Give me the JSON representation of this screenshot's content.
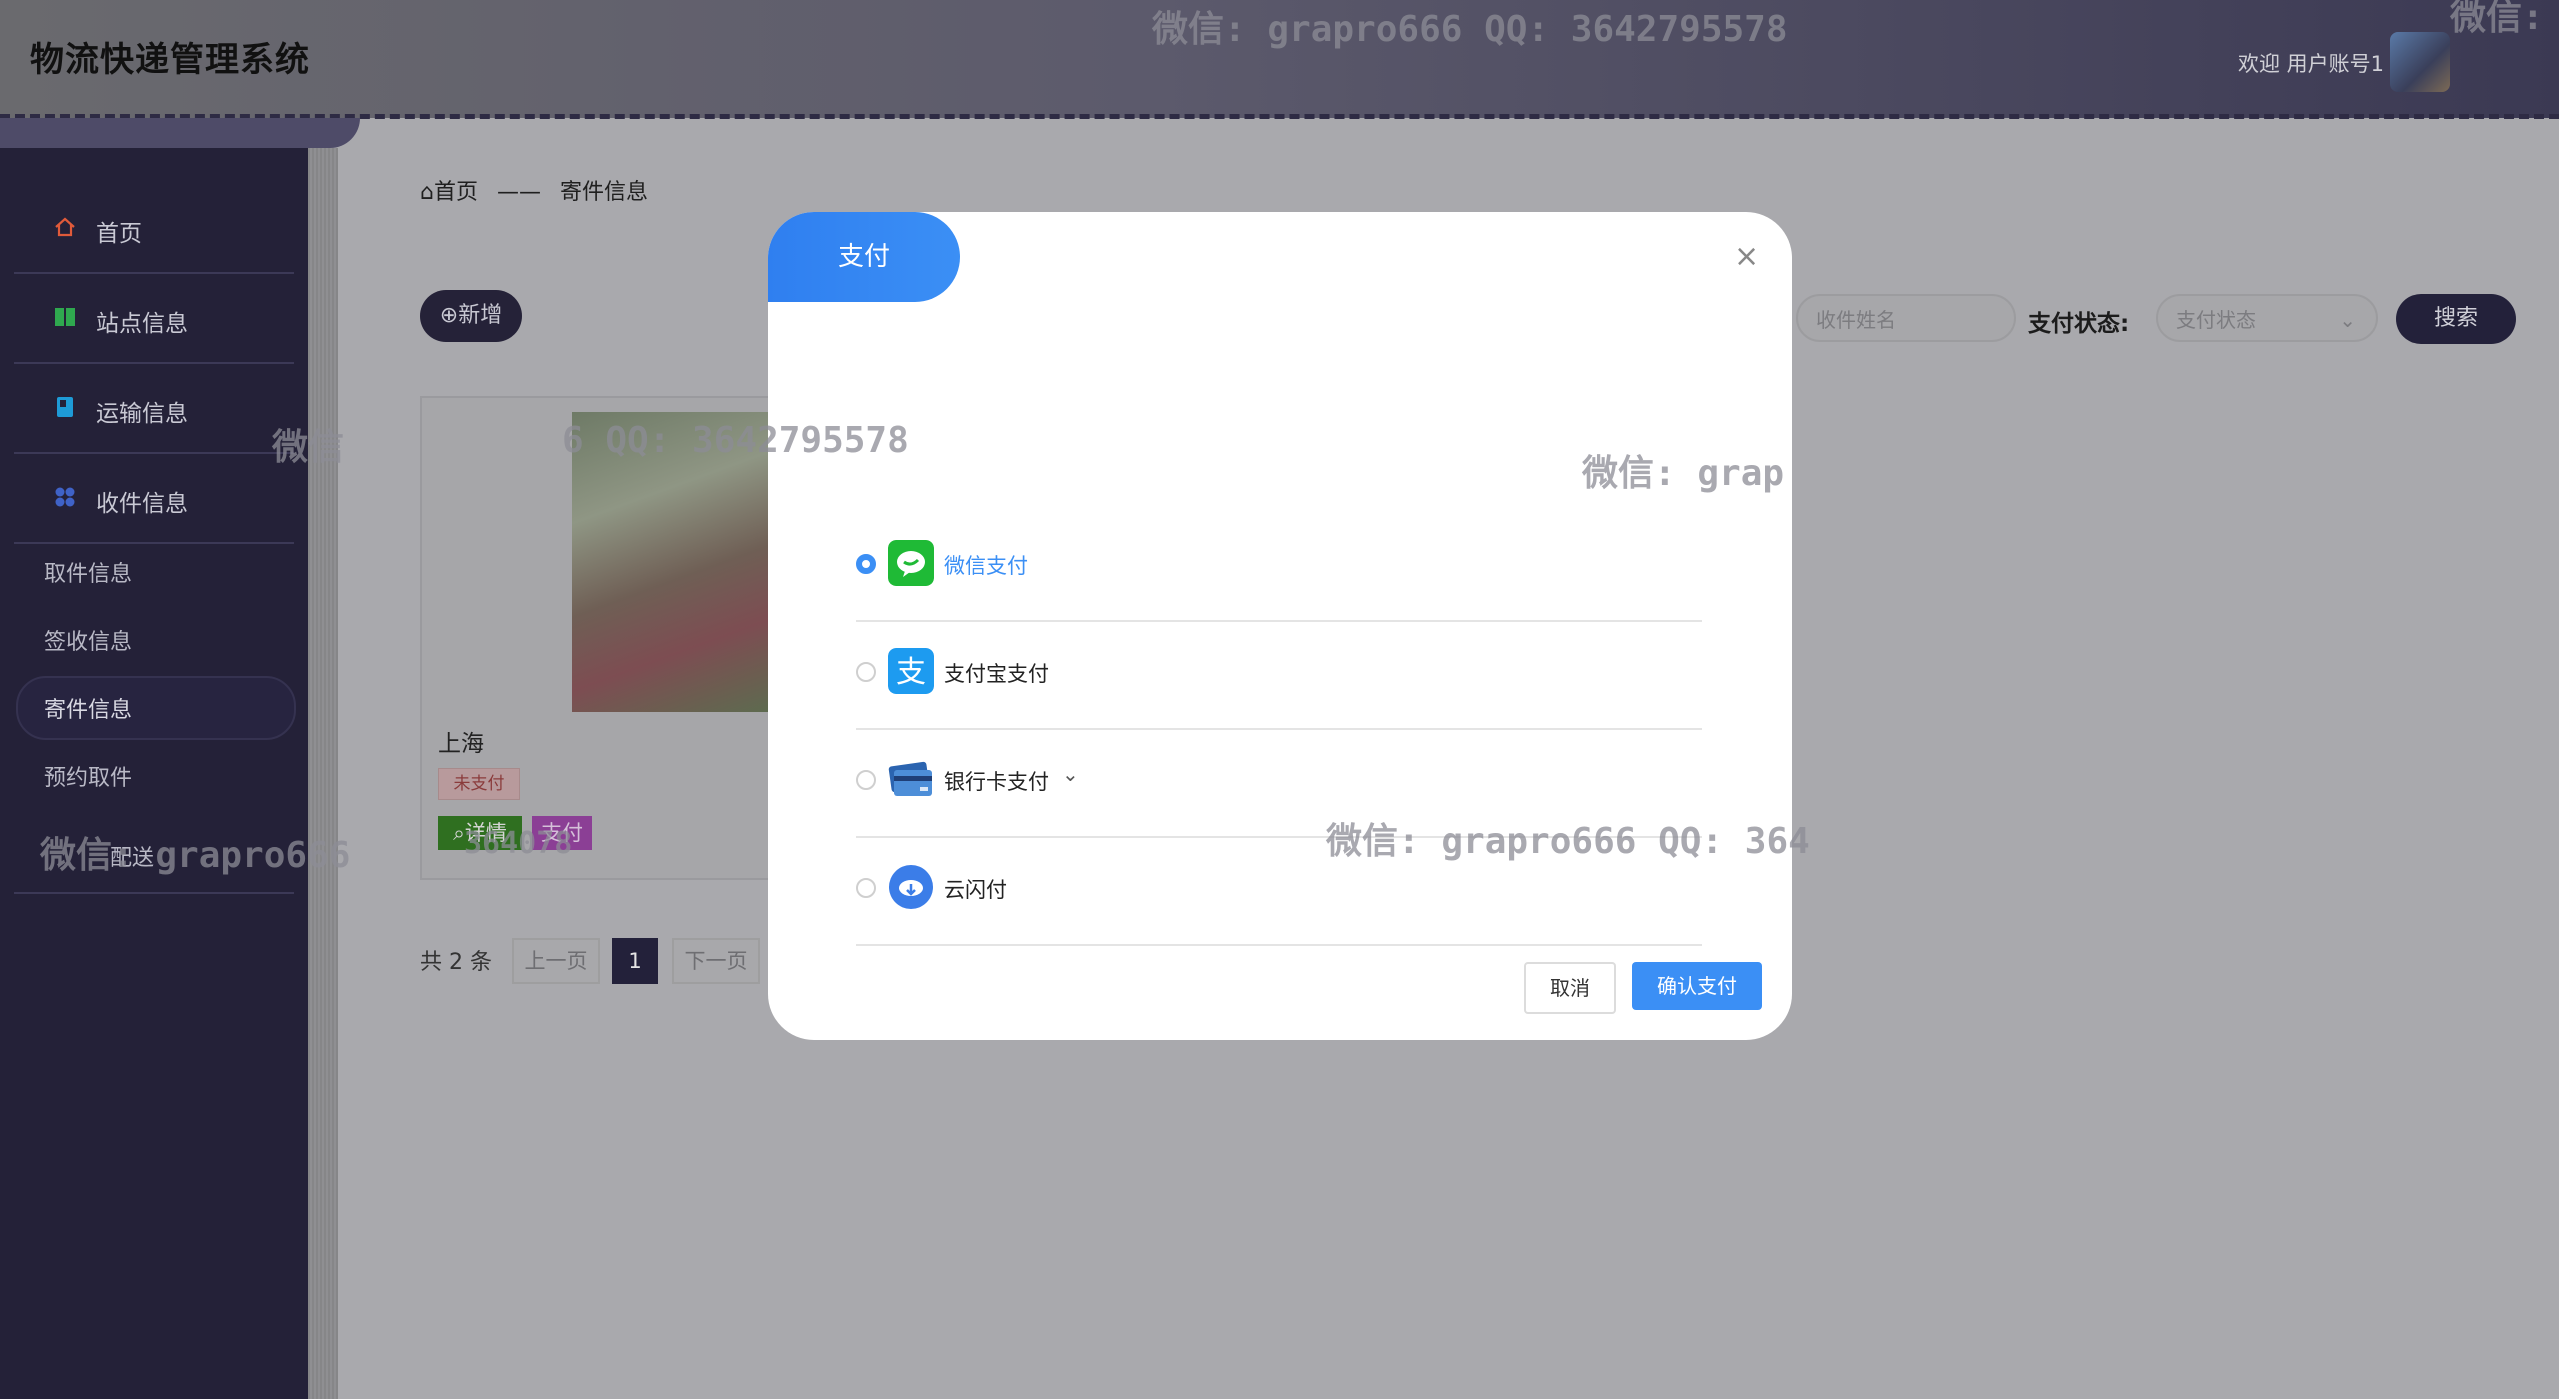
{
  "header": {
    "title": "物流快递管理系统",
    "welcome": "欢迎 用户账号1"
  },
  "sidebar": {
    "items": [
      {
        "label": "首页",
        "icon": "home-icon",
        "color": "#e05a3a"
      },
      {
        "label": "站点信息",
        "icon": "station-icon",
        "color": "#2fa84f"
      },
      {
        "label": "运输信息",
        "icon": "book-icon",
        "color": "#1e9bd7"
      },
      {
        "label": "收件信息",
        "icon": "grid-icon",
        "color": "#3f62c7"
      }
    ],
    "subitems": [
      "取件信息",
      "签收信息",
      "寄件信息",
      "预约取件",
      "配送"
    ]
  },
  "breadcrumb": {
    "home": "首页",
    "sep": "——",
    "current": "寄件信息"
  },
  "toolbar": {
    "add_label": "⊕新增"
  },
  "search": {
    "name_placeholder": "收件姓名",
    "status_label": "支付状态:",
    "status_placeholder": "支付状态",
    "search_label": "搜索"
  },
  "card": {
    "city": "上海",
    "status": "未支付",
    "detail_label": "详情",
    "pay_label": "支付"
  },
  "pagination": {
    "total": "共 2 条",
    "prev": "上一页",
    "current": "1",
    "next": "下一页"
  },
  "watermark": {
    "text_full": "微信: grapro666 QQ: 3642795578",
    "text_a": "微信: grapro666 QQ: 3642795578",
    "text_b": "微信: grapro666 QQ: 364",
    "text_c": "微信: grap",
    "text_d": "微信",
    "text_e": "6 QQ: 3642795578",
    "text_f": "微信: grapro666",
    "text_g": "微信:",
    "text_h": "364078"
  },
  "modal": {
    "title": "支付",
    "options": [
      {
        "label": "微信支付",
        "selected": true,
        "icon": "wechat-icon",
        "color": "#1fba36"
      },
      {
        "label": "支付宝支付",
        "selected": false,
        "icon": "alipay-icon",
        "color": "#1d9bf0"
      },
      {
        "label": "银行卡支付",
        "selected": false,
        "icon": "bank-card-icon",
        "color": "#3a79c8"
      },
      {
        "label": "云闪付",
        "selected": false,
        "icon": "unionpay-cloud-icon",
        "color": "#3b7de8"
      }
    ],
    "cancel_label": "取消",
    "confirm_label": "确认支付"
  }
}
